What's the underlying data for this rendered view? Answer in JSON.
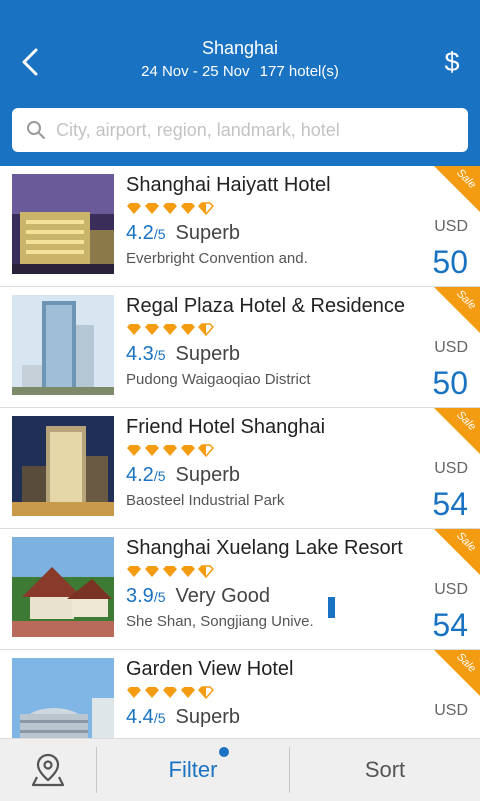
{
  "header": {
    "title": "Shanghai",
    "dates": "24 Nov - 25 Nov",
    "hotel_count": "177 hotel(s)",
    "currency_symbol": "$"
  },
  "search": {
    "placeholder": "City, airport, region, landmark, hotel"
  },
  "sale_badge": "Sale",
  "hotels": [
    {
      "name": "Shanghai Haiyatt Hotel",
      "diamonds": 4.5,
      "score": "4.2",
      "out_of": "/5",
      "rating_label": "Superb",
      "location": "Everbright Convention and.",
      "currency": "USD",
      "price": "50"
    },
    {
      "name": "Regal Plaza Hotel & Residence",
      "diamonds": 4.5,
      "score": "4.3",
      "out_of": "/5",
      "rating_label": "Superb",
      "location": "Pudong Waigaoqiao District",
      "currency": "USD",
      "price": "50"
    },
    {
      "name": "Friend Hotel Shanghai",
      "diamonds": 4.5,
      "score": "4.2",
      "out_of": "/5",
      "rating_label": "Superb",
      "location": "Baosteel Industrial Park",
      "currency": "USD",
      "price": "54"
    },
    {
      "name": "Shanghai Xuelang Lake Resort",
      "diamonds": 4.5,
      "score": "3.9",
      "out_of": "/5",
      "rating_label": "Very Good",
      "location": "She Shan, Songjiang Unive.",
      "currency": "USD",
      "price": "54"
    },
    {
      "name": "Garden View Hotel",
      "diamonds": 4.5,
      "score": "4.4",
      "out_of": "/5",
      "rating_label": "Superb",
      "location": "",
      "currency": "USD",
      "price": ""
    }
  ],
  "bottom_bar": {
    "map_icon": "map-pin-icon",
    "filter_label": "Filter",
    "sort_label": "Sort"
  },
  "colors": {
    "primary": "#1a73c2",
    "diamond": "#f39c12",
    "sale": "#f39c12"
  }
}
